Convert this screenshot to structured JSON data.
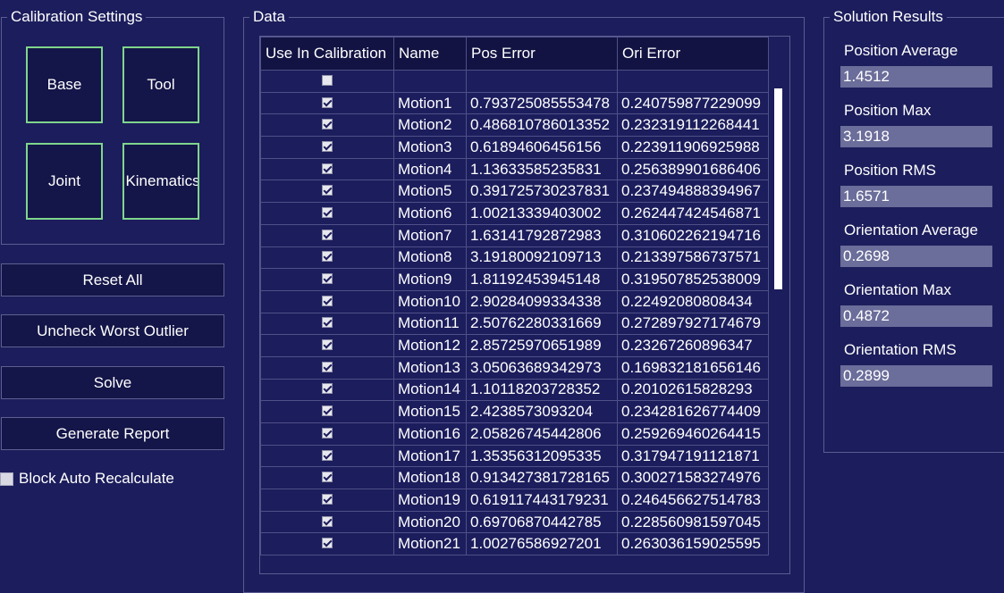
{
  "calibration_settings": {
    "title": "Calibration Settings",
    "buttons": {
      "base": "Base",
      "tool": "Tool",
      "joint": "Joint",
      "kinematics": "Kinematics"
    }
  },
  "actions": {
    "reset_all": "Reset All",
    "uncheck_worst": "Uncheck Worst Outlier",
    "solve": "Solve",
    "generate_report": "Generate Report",
    "block_auto_recalculate": "Block Auto Recalculate",
    "block_auto_recalculate_checked": false
  },
  "data": {
    "title": "Data",
    "columns": [
      "Use In Calibration",
      "Name",
      "Pos Error",
      "Ori Error"
    ],
    "rows": [
      {
        "use": false,
        "name": "",
        "pos": "",
        "ori": ""
      },
      {
        "use": true,
        "name": "Motion1",
        "pos": "0.793725085553478",
        "ori": "0.240759877229099"
      },
      {
        "use": true,
        "name": "Motion2",
        "pos": "0.486810786013352",
        "ori": "0.232319112268441"
      },
      {
        "use": true,
        "name": "Motion3",
        "pos": "0.61894606456156",
        "ori": "0.223911906925988"
      },
      {
        "use": true,
        "name": "Motion4",
        "pos": "1.13633585235831",
        "ori": "0.256389901686406"
      },
      {
        "use": true,
        "name": "Motion5",
        "pos": "0.391725730237831",
        "ori": "0.237494888394967"
      },
      {
        "use": true,
        "name": "Motion6",
        "pos": "1.00213339403002",
        "ori": "0.262447424546871"
      },
      {
        "use": true,
        "name": "Motion7",
        "pos": "1.63141792872983",
        "ori": "0.310602262194716"
      },
      {
        "use": true,
        "name": "Motion8",
        "pos": "3.19180092109713",
        "ori": "0.213397586737571"
      },
      {
        "use": true,
        "name": "Motion9",
        "pos": "1.81192453945148",
        "ori": "0.319507852538009"
      },
      {
        "use": true,
        "name": "Motion10",
        "pos": "2.90284099334338",
        "ori": "0.22492080808434"
      },
      {
        "use": true,
        "name": "Motion11",
        "pos": "2.50762280331669",
        "ori": "0.272897927174679"
      },
      {
        "use": true,
        "name": "Motion12",
        "pos": "2.85725970651989",
        "ori": "0.23267260896347"
      },
      {
        "use": true,
        "name": "Motion13",
        "pos": "3.05063689342973",
        "ori": "0.169832181656146"
      },
      {
        "use": true,
        "name": "Motion14",
        "pos": "1.10118203728352",
        "ori": "0.20102615828293"
      },
      {
        "use": true,
        "name": "Motion15",
        "pos": "2.4238573093204",
        "ori": "0.234281626774409"
      },
      {
        "use": true,
        "name": "Motion16",
        "pos": "2.05826745442806",
        "ori": "0.259269460264415"
      },
      {
        "use": true,
        "name": "Motion17",
        "pos": "1.35356312095335",
        "ori": "0.317947191121871"
      },
      {
        "use": true,
        "name": "Motion18",
        "pos": "0.913427381728165",
        "ori": "0.300271583274976"
      },
      {
        "use": true,
        "name": "Motion19",
        "pos": "0.619117443179231",
        "ori": "0.246456627514783"
      },
      {
        "use": true,
        "name": "Motion20",
        "pos": "0.69706870442785",
        "ori": "0.228560981597045"
      },
      {
        "use": true,
        "name": "Motion21",
        "pos": "1.00276586927201",
        "ori": "0.263036159025595"
      }
    ]
  },
  "results": {
    "title": "Solution Results",
    "items": [
      {
        "label": "Position Average",
        "value": "1.4512"
      },
      {
        "label": "Position Max",
        "value": "3.1918"
      },
      {
        "label": "Position RMS",
        "value": "1.6571"
      },
      {
        "label": "Orientation Average",
        "value": "0.2698"
      },
      {
        "label": "Orientation Max",
        "value": "0.4872"
      },
      {
        "label": "Orientation RMS",
        "value": "0.2899"
      }
    ]
  }
}
